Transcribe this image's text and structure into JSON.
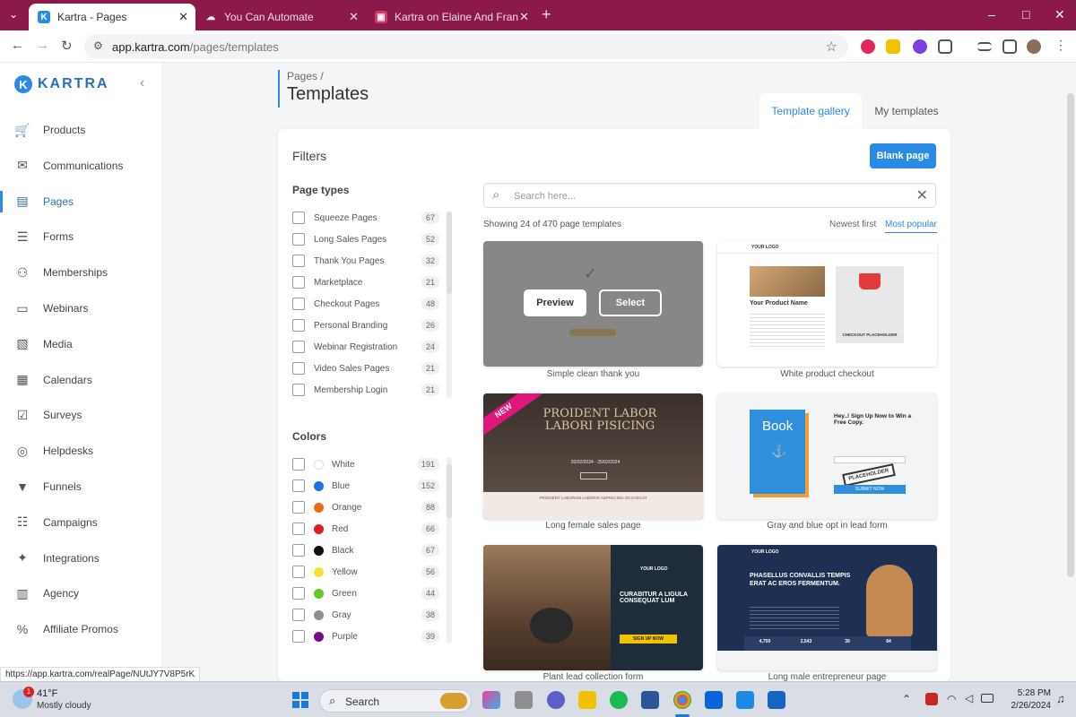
{
  "browser": {
    "tabs": [
      {
        "label": "Kartra - Pages",
        "fav": "K",
        "favcolor": "#2b8ae6"
      },
      {
        "label": "You Can Automate",
        "fav": "☁",
        "favcolor": "transparent"
      },
      {
        "label": "Kartra on Elaine And Fran | Trell",
        "fav": "▣",
        "favcolor": "#d03b6b"
      }
    ],
    "url_host": "app.kartra.com",
    "url_path": "/pages/templates",
    "window_controls": [
      "–",
      "□",
      "✕"
    ]
  },
  "sidebar": {
    "logo_text": "KARTRA",
    "logo_mark": "K",
    "items": [
      {
        "label": "Products",
        "icon": "cart-icon",
        "glyph": "🛒"
      },
      {
        "label": "Communications",
        "icon": "envelope-icon",
        "glyph": "✉"
      },
      {
        "label": "Pages",
        "icon": "pages-icon",
        "glyph": "▤"
      },
      {
        "label": "Forms",
        "icon": "clipboard-icon",
        "glyph": "☰"
      },
      {
        "label": "Memberships",
        "icon": "people-icon",
        "glyph": "⚇"
      },
      {
        "label": "Webinars",
        "icon": "presentation-icon",
        "glyph": "▭"
      },
      {
        "label": "Media",
        "icon": "images-icon",
        "glyph": "▧"
      },
      {
        "label": "Calendars",
        "icon": "calendar-icon",
        "glyph": "▦"
      },
      {
        "label": "Surveys",
        "icon": "checkbox-icon",
        "glyph": "☑"
      },
      {
        "label": "Helpdesks",
        "icon": "lifebuoy-icon",
        "glyph": "◎"
      },
      {
        "label": "Funnels",
        "icon": "funnel-icon",
        "glyph": "▼"
      },
      {
        "label": "Campaigns",
        "icon": "sitemap-icon",
        "glyph": "☷"
      },
      {
        "label": "Integrations",
        "icon": "puzzle-icon",
        "glyph": "✦"
      },
      {
        "label": "Agency",
        "icon": "building-icon",
        "glyph": "▥"
      },
      {
        "label": "Affiliate Promos",
        "icon": "percent-icon",
        "glyph": "%"
      }
    ],
    "active": "Pages"
  },
  "header": {
    "breadcrumb_parent": "Pages /",
    "title": "Templates",
    "tabs": [
      "Template gallery",
      "My templates"
    ]
  },
  "filters": {
    "title": "Filters",
    "page_types_title": "Page types",
    "page_types": [
      {
        "label": "Squeeze Pages",
        "count": "67"
      },
      {
        "label": "Long Sales Pages",
        "count": "52"
      },
      {
        "label": "Thank You Pages",
        "count": "32"
      },
      {
        "label": "Marketplace",
        "count": "21"
      },
      {
        "label": "Checkout Pages",
        "count": "48"
      },
      {
        "label": "Personal Branding",
        "count": "26"
      },
      {
        "label": "Webinar Registration",
        "count": "24"
      },
      {
        "label": "Video Sales Pages",
        "count": "21"
      },
      {
        "label": "Membership Login",
        "count": "21"
      }
    ],
    "colors_title": "Colors",
    "colors": [
      {
        "label": "White",
        "count": "191",
        "color": "#ffffff"
      },
      {
        "label": "Blue",
        "count": "152",
        "color": "#1a73e8"
      },
      {
        "label": "Orange",
        "count": "88",
        "color": "#f06a14"
      },
      {
        "label": "Red",
        "count": "66",
        "color": "#e01e1e"
      },
      {
        "label": "Black",
        "count": "67",
        "color": "#111111"
      },
      {
        "label": "Yellow",
        "count": "56",
        "color": "#f5e13a"
      },
      {
        "label": "Green",
        "count": "44",
        "color": "#5ecb2a"
      },
      {
        "label": "Gray",
        "count": "38",
        "color": "#8e8e8e"
      },
      {
        "label": "Purple",
        "count": "39",
        "color": "#7d0a8a"
      }
    ]
  },
  "gallery": {
    "blank_page": "Blank page",
    "search_placeholder": "Search here...",
    "showing": "Showing 24 of 470 page templates",
    "sort_newest": "Newest first",
    "sort_popular": "Most popular",
    "preview": "Preview",
    "select": "Select",
    "cards": [
      {
        "caption": "Simple clean thank you"
      },
      {
        "caption": "White product checkout",
        "logo": "YOUR LOGO",
        "product": "Your Product Name",
        "checkout": "CHECKOUT PLACEHOLDER"
      },
      {
        "caption": "Long female sales page",
        "badge": "NEW",
        "headline": "PROIDENT LABOR LABORI PISICING",
        "dates": "20/02/2024 - 25/02/2024",
        "footer": "PROIDENT LABORUM LABORIS ASPISICING OCCAECAT"
      },
      {
        "caption": "Gray and blue opt in lead form",
        "book": "Book",
        "signup": "Hey..! Sign Up Now to Win a Free Copy.",
        "stamp": "PLACEHOLDER",
        "submit": "SUBMIT NOW"
      },
      {
        "caption": "Plant lead collection form",
        "logo": "YOUR LOGO",
        "headline": "CURABITUR A LIGULA CONSEQUAT LUM",
        "cta": "SIGN UP NOW"
      },
      {
        "caption": "Long male entrepreneur page",
        "logo": "YOUR LOGO",
        "headline": "PHASELLUS CONVALLIS TEMPIS ERAT AC EROS FERMENTUM.",
        "stats": [
          "4,750",
          "2,543",
          "39",
          "84"
        ]
      }
    ]
  },
  "status_url": "https://app.kartra.com/realPage/NUtJY7V8P5rK",
  "taskbar": {
    "weather_temp": "41°F",
    "weather_desc": "Mostly cloudy",
    "weather_badge": "1",
    "search": "Search",
    "time": "5:28 PM",
    "date": "2/26/2024"
  }
}
